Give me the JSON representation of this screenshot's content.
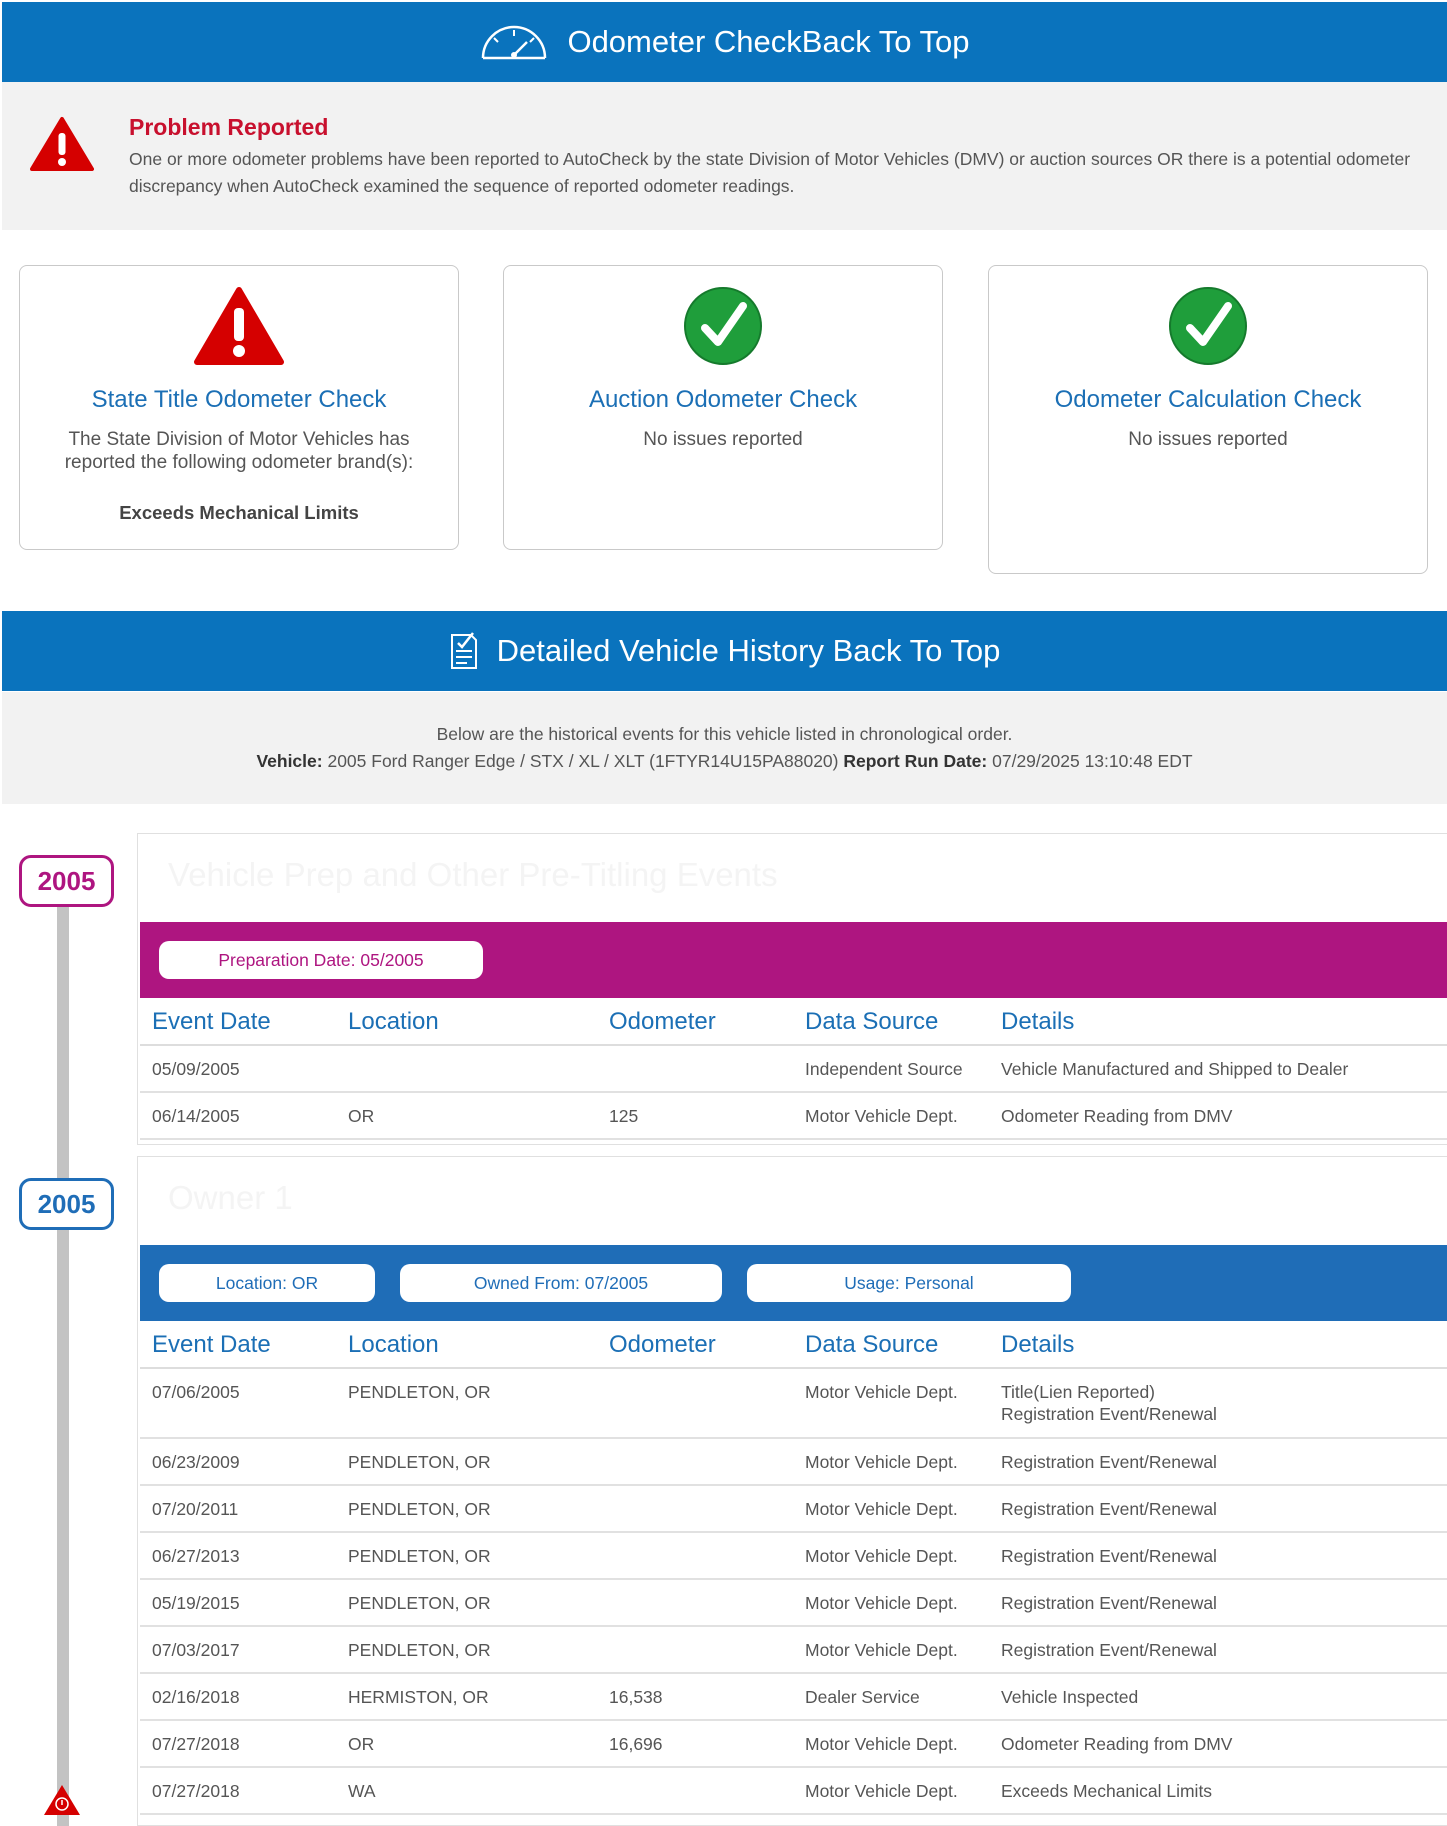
{
  "odometer_section": {
    "title": "Odometer Check",
    "back_link": "Back To Top"
  },
  "problem": {
    "title": "Problem Reported",
    "text": "One or more odometer problems have been reported to AutoCheck by the state Division of Motor Vehicles (DMV) or auction sources OR there is a potential odometer discrepancy when AutoCheck examined the sequence of reported odometer readings."
  },
  "checks": [
    {
      "title": "State Title Odometer Check",
      "status": "problem",
      "description": "The State Division of Motor Vehicles has reported the following odometer brand(s):",
      "brand": "Exceeds Mechanical Limits"
    },
    {
      "title": "Auction Odometer Check",
      "status": "ok",
      "description": "No issues reported"
    },
    {
      "title": "Odometer Calculation Check",
      "status": "ok",
      "description": "No issues reported"
    }
  ],
  "history_section": {
    "title": "Detailed Vehicle History",
    "back_link": "Back To Top",
    "intro": "Below are the historical events for this vehicle listed in chronological order.",
    "vehicle_label": "Vehicle:",
    "vehicle_value": "2005 Ford Ranger Edge / STX / XL / XLT (1FTYR14U15PA88020)",
    "run_date_label": "Report Run Date:",
    "run_date_value": "07/29/2025 13:10:48 EDT"
  },
  "columns": [
    "Event Date",
    "Location",
    "Odometer",
    "Data Source",
    "Details"
  ],
  "groups": [
    {
      "year": "2005",
      "color": "#ae1580",
      "title": "Vehicle Prep and Other Pre-Titling Events",
      "pills": [
        {
          "label": "Preparation Date:",
          "value": "05/2005"
        }
      ],
      "rows": [
        {
          "date": "05/09/2005",
          "location": "",
          "odometer": "",
          "source": "Independent Source",
          "details": [
            "Vehicle Manufactured and Shipped to Dealer"
          ]
        },
        {
          "date": "06/14/2005",
          "location": "OR",
          "odometer": "125",
          "source": "Motor Vehicle Dept.",
          "details": [
            "Odometer Reading from DMV"
          ]
        }
      ]
    },
    {
      "year": "2005",
      "color": "#1f6db7",
      "title": "Owner 1",
      "pills": [
        {
          "label": "Location:",
          "value": "OR"
        },
        {
          "label": "Owned From:",
          "value": "07/2005"
        },
        {
          "label": "Usage:",
          "value": "Personal"
        }
      ],
      "rows": [
        {
          "date": "07/06/2005",
          "location": "PENDLETON, OR",
          "odometer": "",
          "source": "Motor Vehicle Dept.",
          "details": [
            "Title(Lien Reported)",
            "Registration Event/Renewal"
          ]
        },
        {
          "date": "06/23/2009",
          "location": "PENDLETON, OR",
          "odometer": "",
          "source": "Motor Vehicle Dept.",
          "details": [
            "Registration Event/Renewal"
          ]
        },
        {
          "date": "07/20/2011",
          "location": "PENDLETON, OR",
          "odometer": "",
          "source": "Motor Vehicle Dept.",
          "details": [
            "Registration Event/Renewal"
          ]
        },
        {
          "date": "06/27/2013",
          "location": "PENDLETON, OR",
          "odometer": "",
          "source": "Motor Vehicle Dept.",
          "details": [
            "Registration Event/Renewal"
          ]
        },
        {
          "date": "05/19/2015",
          "location": "PENDLETON, OR",
          "odometer": "",
          "source": "Motor Vehicle Dept.",
          "details": [
            "Registration Event/Renewal"
          ]
        },
        {
          "date": "07/03/2017",
          "location": "PENDLETON, OR",
          "odometer": "",
          "source": "Motor Vehicle Dept.",
          "details": [
            "Registration Event/Renewal"
          ]
        },
        {
          "date": "02/16/2018",
          "location": "HERMISTON, OR",
          "odometer": "16,538",
          "source": "Dealer Service",
          "details": [
            "Vehicle Inspected"
          ]
        },
        {
          "date": "07/27/2018",
          "location": "OR",
          "odometer": "16,696",
          "source": "Motor Vehicle Dept.",
          "details": [
            "Odometer Reading from DMV"
          ]
        },
        {
          "date": "07/27/2018",
          "location": "WA",
          "odometer": "",
          "source": "Motor Vehicle Dept.",
          "details": [
            "Exceeds Mechanical Limits"
          ]
        }
      ]
    }
  ]
}
